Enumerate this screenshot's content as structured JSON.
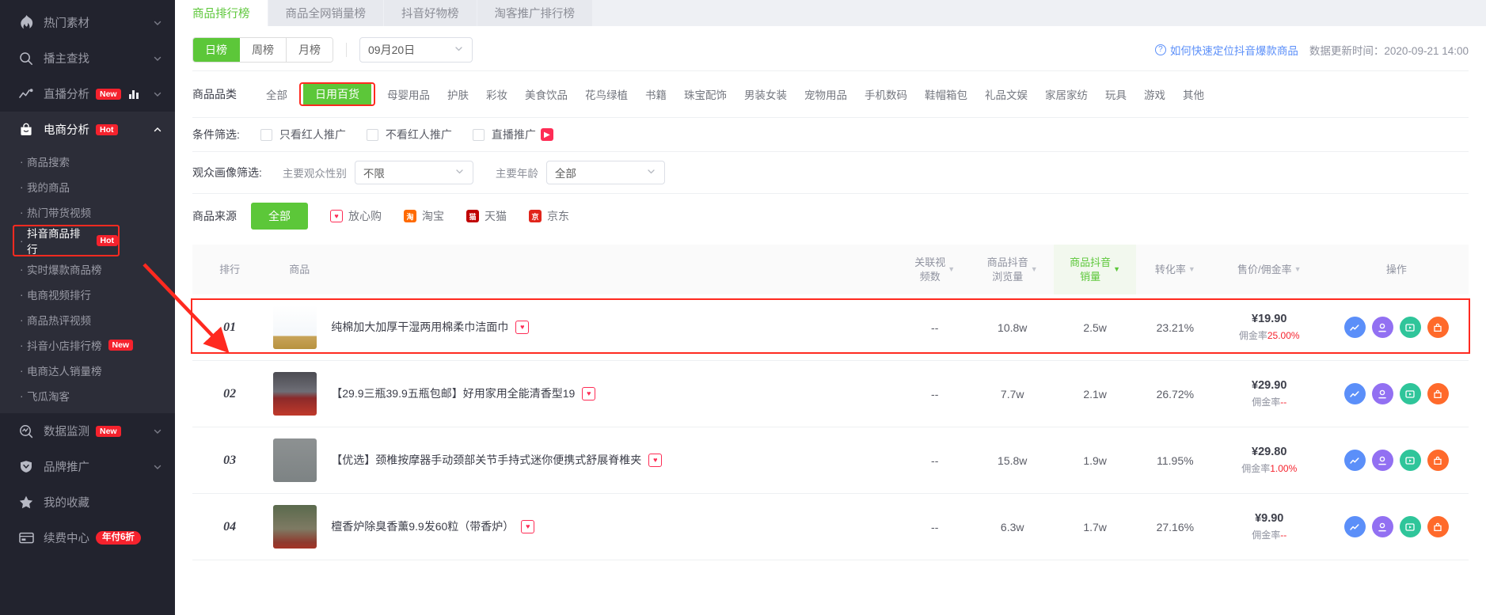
{
  "sidebar": {
    "items": [
      {
        "label": "热门素材",
        "icon": "fire-icon",
        "chevron": "down",
        "badge": null
      },
      {
        "label": "播主查找",
        "icon": "search-icon",
        "chevron": "down",
        "badge": null
      },
      {
        "label": "直播分析",
        "icon": "trend-icon",
        "chevron": "down",
        "badge": "New",
        "chart": true
      },
      {
        "label": "电商分析",
        "icon": "bag-icon",
        "chevron": "up",
        "badge": "Hot",
        "active": true
      }
    ],
    "subitems": [
      {
        "label": "商品搜索",
        "badge": null,
        "highlight": false
      },
      {
        "label": "我的商品",
        "badge": null,
        "highlight": false
      },
      {
        "label": "热门带货视频",
        "badge": null,
        "highlight": false
      },
      {
        "label": "抖音商品排行",
        "badge": "Hot",
        "highlight": true
      },
      {
        "label": "实时爆款商品榜",
        "badge": null,
        "highlight": false
      },
      {
        "label": "电商视频排行",
        "badge": null,
        "highlight": false
      },
      {
        "label": "商品热评视频",
        "badge": null,
        "highlight": false
      },
      {
        "label": "抖音小店排行榜",
        "badge": "New",
        "highlight": false
      },
      {
        "label": "电商达人销量榜",
        "badge": null,
        "highlight": false
      },
      {
        "label": "飞瓜淘客",
        "badge": null,
        "highlight": false
      }
    ],
    "bottom_items": [
      {
        "label": "数据监测",
        "icon": "monitor-icon",
        "chevron": "down",
        "badge": "New"
      },
      {
        "label": "品牌推广",
        "icon": "shield-icon",
        "chevron": "down",
        "badge": null
      },
      {
        "label": "我的收藏",
        "icon": "star-icon",
        "chevron": null,
        "badge": null
      },
      {
        "label": "续费中心",
        "icon": "card-icon",
        "chevron": null,
        "badge": "年付6折",
        "badge_pill": true
      }
    ]
  },
  "tabs": [
    {
      "label": "商品排行榜",
      "active": true
    },
    {
      "label": "商品全网销量榜",
      "active": false
    },
    {
      "label": "抖音好物榜",
      "active": false
    },
    {
      "label": "淘客推广排行榜",
      "active": false
    }
  ],
  "toolbar": {
    "periods": [
      {
        "label": "日榜",
        "active": true
      },
      {
        "label": "周榜",
        "active": false
      },
      {
        "label": "月榜",
        "active": false
      }
    ],
    "date_value": "09月20日",
    "help_label": "如何快速定位抖音爆款商品",
    "update_time": "数据更新时间：2020-09-21 14:00"
  },
  "category_filter": {
    "label": "商品品类",
    "categories": [
      {
        "label": "全部",
        "active": false,
        "highlight": false
      },
      {
        "label": "日用百货",
        "active": true,
        "highlight": true
      },
      {
        "label": "母婴用品",
        "active": false,
        "highlight": false
      },
      {
        "label": "护肤",
        "active": false,
        "highlight": false
      },
      {
        "label": "彩妆",
        "active": false,
        "highlight": false
      },
      {
        "label": "美食饮品",
        "active": false,
        "highlight": false
      },
      {
        "label": "花鸟绿植",
        "active": false,
        "highlight": false
      },
      {
        "label": "书籍",
        "active": false,
        "highlight": false
      },
      {
        "label": "珠宝配饰",
        "active": false,
        "highlight": false
      },
      {
        "label": "男装女装",
        "active": false,
        "highlight": false
      },
      {
        "label": "宠物用品",
        "active": false,
        "highlight": false
      },
      {
        "label": "手机数码",
        "active": false,
        "highlight": false
      },
      {
        "label": "鞋帽箱包",
        "active": false,
        "highlight": false
      },
      {
        "label": "礼品文娱",
        "active": false,
        "highlight": false
      },
      {
        "label": "家居家纺",
        "active": false,
        "highlight": false
      },
      {
        "label": "玩具",
        "active": false,
        "highlight": false
      },
      {
        "label": "游戏",
        "active": false,
        "highlight": false
      },
      {
        "label": "其他",
        "active": false,
        "highlight": false
      }
    ]
  },
  "condition_filter": {
    "label": "条件筛选:",
    "options": [
      {
        "label": "只看红人推广",
        "checked": false,
        "icon": null
      },
      {
        "label": "不看红人推广",
        "checked": false,
        "icon": null
      },
      {
        "label": "直播推广",
        "checked": false,
        "icon": "douyin-live-icon"
      }
    ]
  },
  "audience_filter": {
    "label": "观众画像筛选:",
    "gender_label": "主要观众性别",
    "gender_value": "不限",
    "age_label": "主要年龄",
    "age_value": "全部"
  },
  "source_filter": {
    "label": "商品来源",
    "sources": [
      {
        "label": "全部",
        "active": true,
        "icon": null,
        "color": "#5cc739"
      },
      {
        "label": "放心购",
        "active": false,
        "icon": "fangxingou-icon",
        "color": "#fe2c55"
      },
      {
        "label": "淘宝",
        "active": false,
        "icon": "taobao-icon",
        "color": "#ff6a00"
      },
      {
        "label": "天猫",
        "active": false,
        "icon": "tmall-icon",
        "color": "#c00000"
      },
      {
        "label": "京东",
        "active": false,
        "icon": "jd-icon",
        "color": "#e1251b"
      }
    ]
  },
  "table": {
    "headers": [
      {
        "label": "排行",
        "sortable": false,
        "highlight": false
      },
      {
        "label": "商品",
        "sortable": false,
        "highlight": false
      },
      {
        "label": "关联视\n频数",
        "sortable": true,
        "highlight": false
      },
      {
        "label": "商品抖音\n浏览量",
        "sortable": true,
        "highlight": false
      },
      {
        "label": "商品抖音\n销量",
        "sortable": true,
        "highlight": true
      },
      {
        "label": "转化率",
        "sortable": true,
        "highlight": false
      },
      {
        "label": "售价/佣金率",
        "sortable": true,
        "highlight": false
      },
      {
        "label": "操作",
        "sortable": false,
        "highlight": false
      }
    ],
    "rows": [
      {
        "rank": "01",
        "title": "纯棉加大加厚干湿两用棉柔巾洁面巾",
        "video_count": "--",
        "views": "10.8w",
        "sales": "2.5w",
        "conversion": "23.21%",
        "price": "¥19.90",
        "commission_label": "佣金率",
        "commission_value": "25.00%",
        "highlight": true,
        "thumb": "th1"
      },
      {
        "rank": "02",
        "title": "【29.9三瓶39.9五瓶包邮】好用家用全能清香型19",
        "video_count": "--",
        "views": "7.7w",
        "sales": "2.1w",
        "conversion": "26.72%",
        "price": "¥29.90",
        "commission_label": "佣金率",
        "commission_value": "--",
        "highlight": false,
        "thumb": "th2"
      },
      {
        "rank": "03",
        "title": "【优选】颈椎按摩器手动颈部关节手持式迷你便携式舒展脊椎夹",
        "video_count": "--",
        "views": "15.8w",
        "sales": "1.9w",
        "conversion": "11.95%",
        "price": "¥29.80",
        "commission_label": "佣金率",
        "commission_value": "1.00%",
        "highlight": false,
        "thumb": "th3"
      },
      {
        "rank": "04",
        "title": "檀香炉除臭香薰9.9发60粒（带香炉）",
        "video_count": "--",
        "views": "6.3w",
        "sales": "1.7w",
        "conversion": "27.16%",
        "price": "¥9.90",
        "commission_label": "佣金率",
        "commission_value": "--",
        "highlight": false,
        "thumb": "th4"
      }
    ],
    "op_buttons": [
      {
        "name": "trend-chart-icon",
        "color": "#5b8ff9"
      },
      {
        "name": "influencer-icon",
        "color": "#9270f2"
      },
      {
        "name": "video-play-icon",
        "color": "#2fc59a"
      },
      {
        "name": "shop-icon",
        "color": "#ff6a2b"
      }
    ]
  },
  "colors": {
    "brand_green": "#5cc739",
    "annotation_red": "#ff2a20",
    "link_blue": "#5b8ff9",
    "sidebar_bg": "#22232e"
  }
}
